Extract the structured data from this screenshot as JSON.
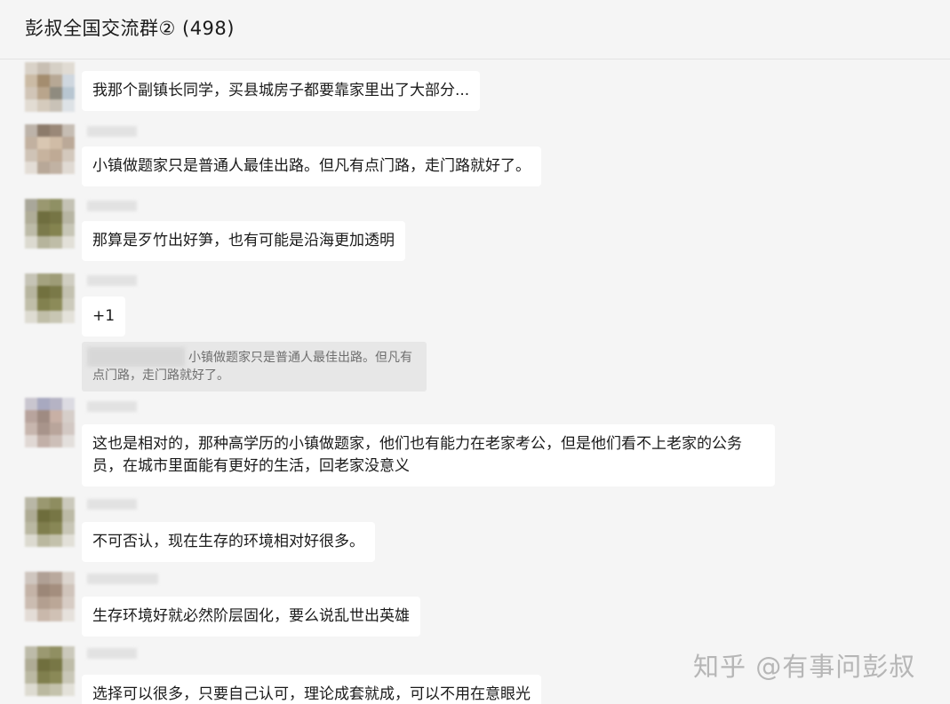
{
  "chat": {
    "title": "彭叔全国交流群② (498)"
  },
  "messages": [
    {
      "text": "我那个副镇长同学，买县城房子都要靠家里出了大部分..."
    },
    {
      "text": "小镇做题家只是普通人最佳出路。但凡有点门路，走门路就好了。"
    },
    {
      "text": "那算是歹竹出好笋，也有可能是沿海更加透明"
    },
    {
      "text": "+1",
      "quote": "小镇做题家只是普通人最佳出路。但凡有点门路，走门路就好了。"
    },
    {
      "text": "这也是相对的，那种高学历的小镇做题家，他们也有能力在老家考公，但是他们看不上老家的公务员，在城市里面能有更好的生活，回老家没意义"
    },
    {
      "text": "不可否认，现在生存的环境相对好很多。"
    },
    {
      "text": "生存环境好就必然阶层固化，要么说乱世出英雄"
    },
    {
      "text": "选择可以很多，只要自己认可，理论成套就成，可以不用在意眼光"
    }
  ],
  "watermark": "知乎 @有事问彭叔",
  "colors": {
    "background": "#f5f5f5",
    "bubble": "#ffffff",
    "quote_bg": "#e7e7e7"
  }
}
